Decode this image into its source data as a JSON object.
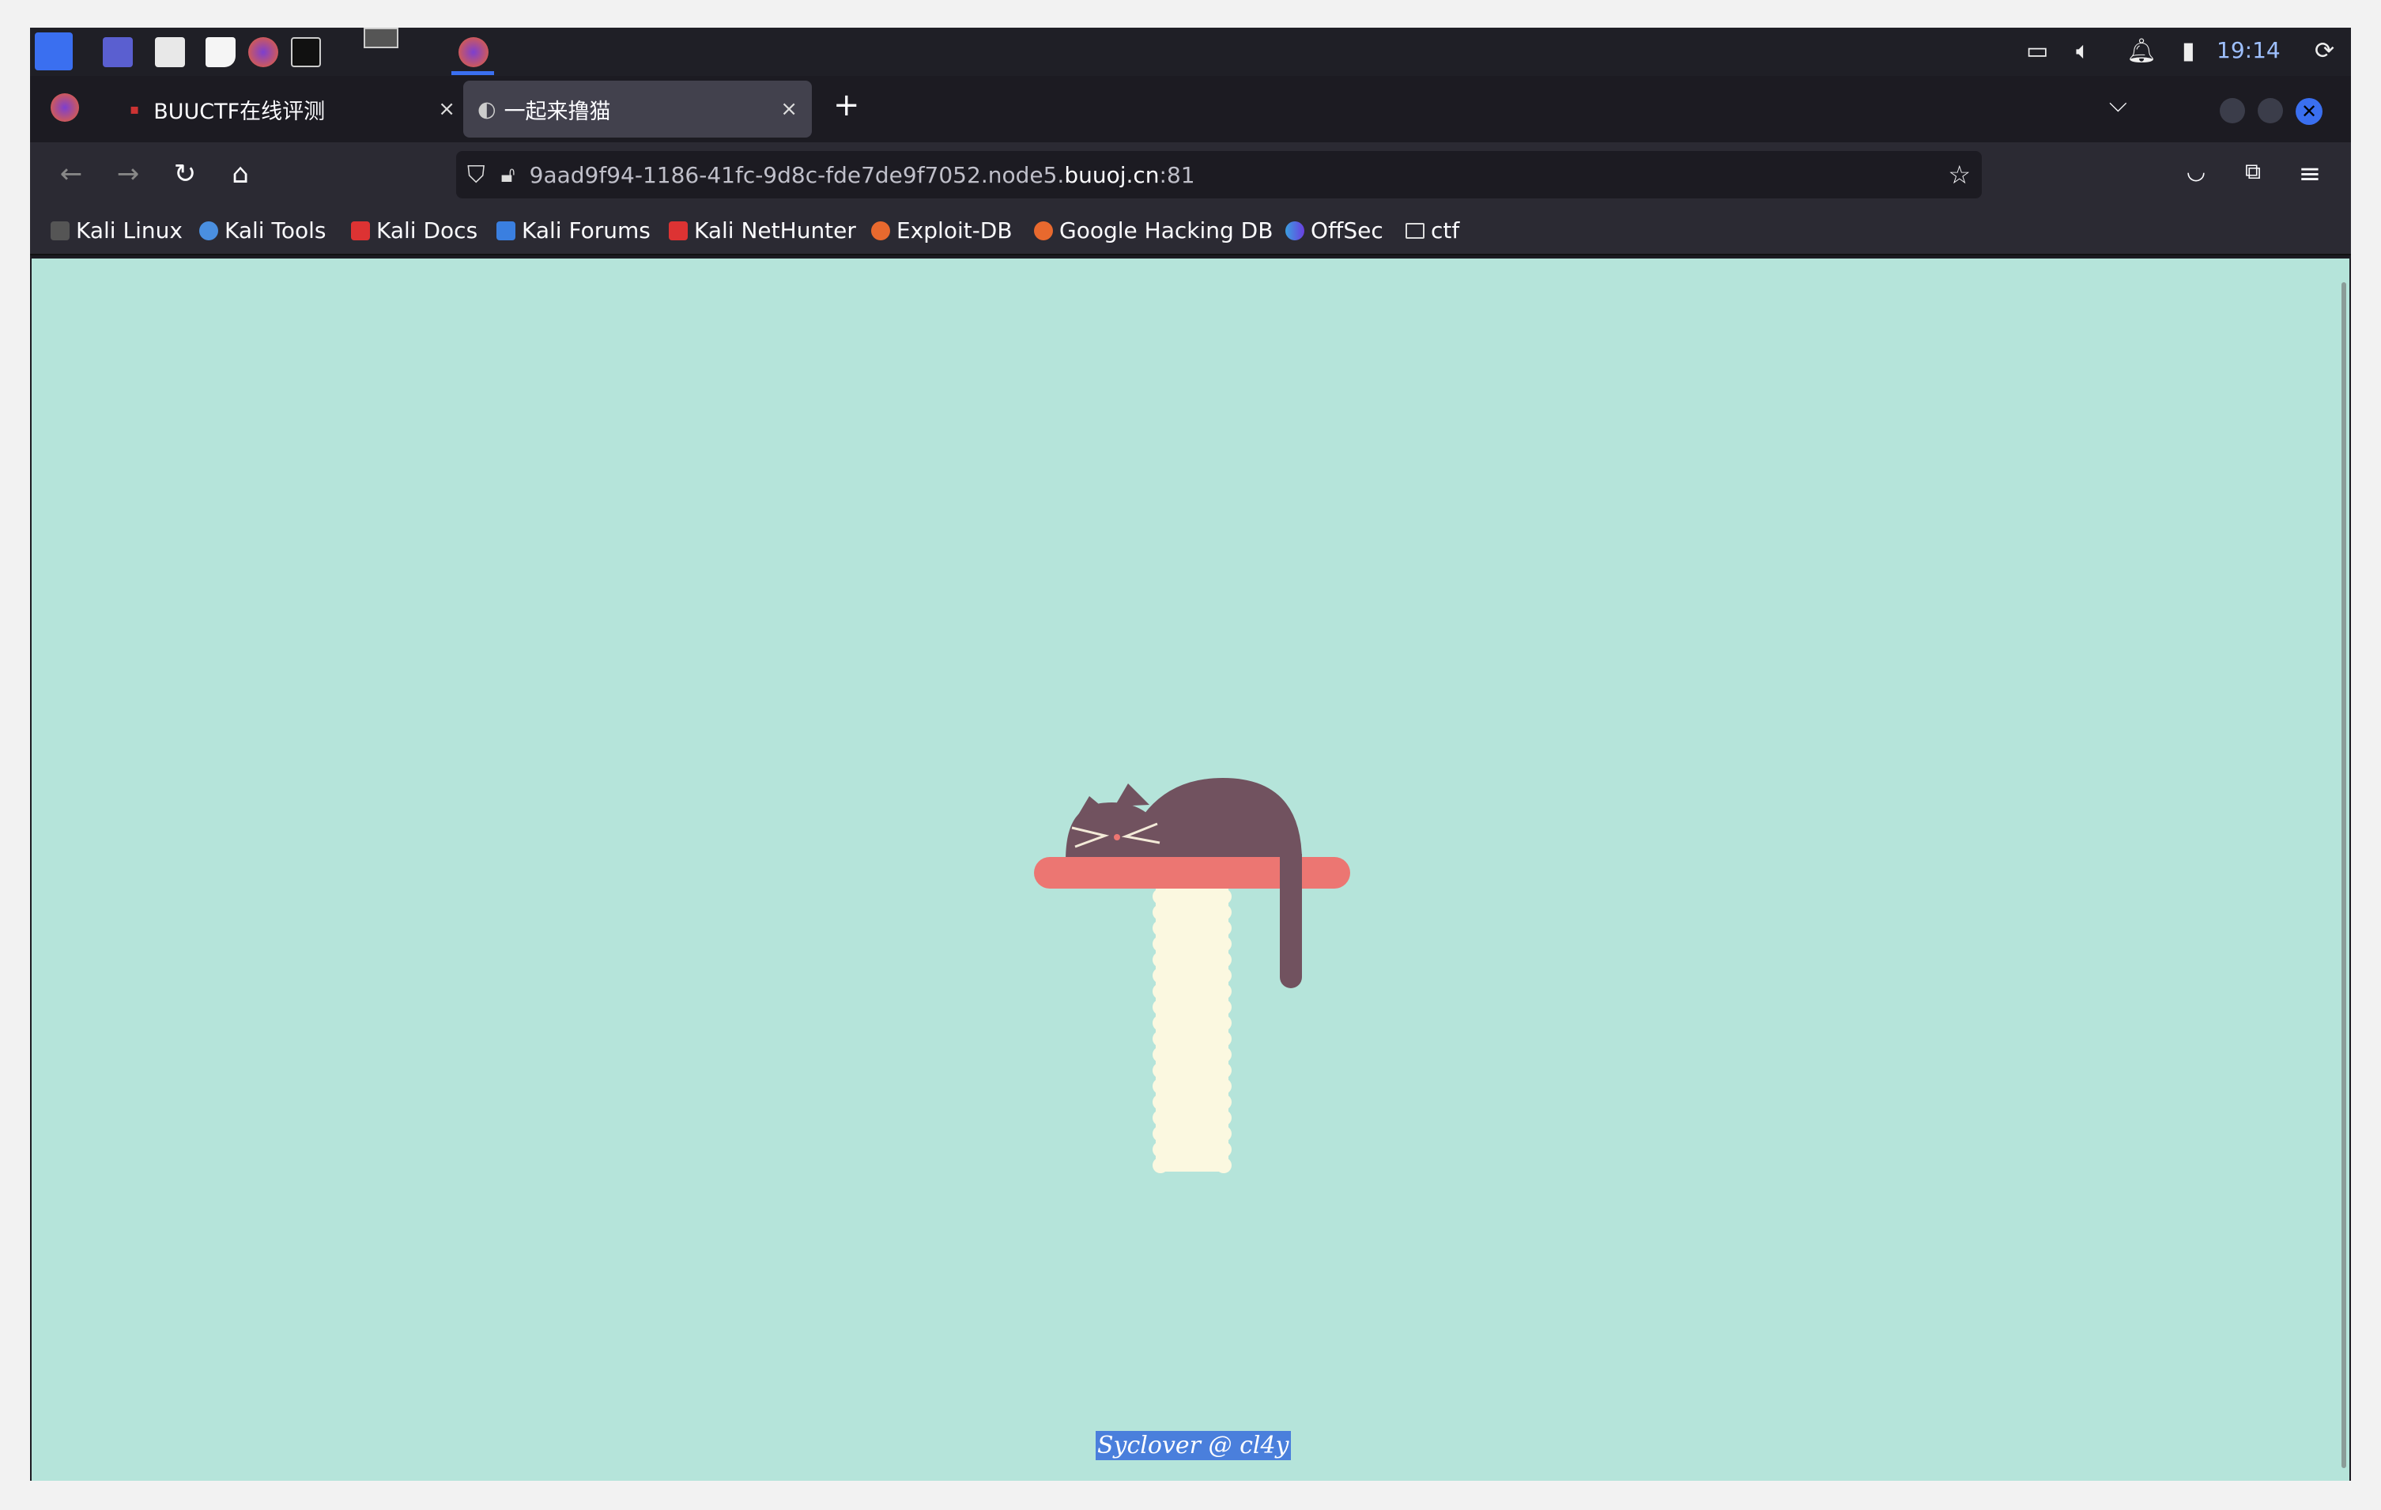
{
  "taskbar": {
    "clock": "19:14",
    "icons": [
      "kali-menu-icon",
      "workspace-icon",
      "file-manager-icon",
      "text-editor-icon",
      "firefox-icon",
      "terminal-icon"
    ]
  },
  "tabs": [
    {
      "label": "BUUCTF在线评测",
      "active": false
    },
    {
      "label": "一起来撸猫",
      "active": true
    }
  ],
  "new_tab_label": "+",
  "close_label": "×",
  "url": {
    "prefix": "9aad9f94-1186-41fc-9d8c-fde7de9f7052.node5.",
    "domain": "buuoj.cn",
    "suffix": ":81"
  },
  "bookmarks": [
    {
      "label": "Kali Linux",
      "color": "#ddd"
    },
    {
      "label": "Kali Tools",
      "color": "#4a8fe0"
    },
    {
      "label": "Kali Docs",
      "color": "#d33"
    },
    {
      "label": "Kali Forums",
      "color": "#3a7fe0"
    },
    {
      "label": "Kali NetHunter",
      "color": "#d33"
    },
    {
      "label": "Exploit-DB",
      "color": "#e8692e"
    },
    {
      "label": "Google Hacking DB",
      "color": "#e8692e"
    },
    {
      "label": "OffSec",
      "color": "#3a6fe0"
    },
    {
      "label": "ctf",
      "color": "folder"
    }
  ],
  "page": {
    "background": "#b5e4da",
    "footer": "Syclover @ cl4y",
    "colors": {
      "cat": "#71525f",
      "platform": "#ec7672",
      "post": "#fbf8e0"
    }
  }
}
